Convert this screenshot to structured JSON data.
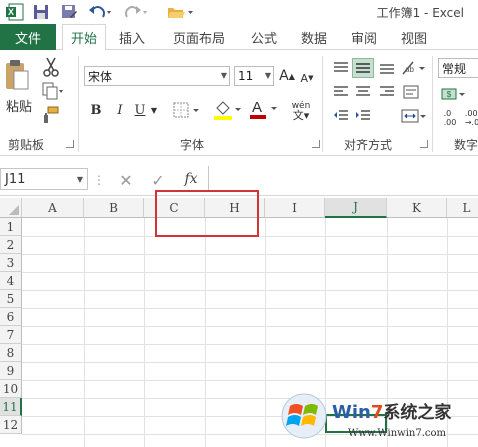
{
  "window": {
    "title": "工作簿1 - Excel"
  },
  "tabs": {
    "file": "文件",
    "home": "开始",
    "insert": "插入",
    "layout": "页面布局",
    "formulas": "公式",
    "data": "数据",
    "review": "审阅",
    "view": "视图"
  },
  "clipboard": {
    "paste": "粘贴",
    "label": "剪贴板"
  },
  "font": {
    "name": "宋体",
    "size": "11",
    "bold": "B",
    "italic": "I",
    "underline": "U",
    "grow": "A",
    "shrink": "A",
    "color_letter": "A",
    "phonetic": "wén",
    "label": "字体"
  },
  "alignment": {
    "label": "对齐方式"
  },
  "number": {
    "format": "常规",
    "label": "数字",
    "inc_decimal": ".0\n.00",
    "dec_decimal": ".00\n→.0"
  },
  "formula_bar": {
    "name_box": "J11",
    "fx": "fx",
    "value": ""
  },
  "columns": [
    "A",
    "B",
    "C",
    "H",
    "I",
    "J",
    "K",
    "L"
  ],
  "selected_column": "J",
  "rows": [
    "1",
    "2",
    "3",
    "4",
    "5",
    "6",
    "7",
    "8",
    "9",
    "10",
    "11",
    "12"
  ],
  "selected_row": "11",
  "watermark": {
    "brand_prefix": "Win",
    "brand_num": "7",
    "brand_cn": "系统之家",
    "url": "Www.Winwin7.com"
  },
  "colors": {
    "accent": "#217346",
    "highlight_box": "#d13438",
    "font_color": "#c00000",
    "fill_color": "#ffff00"
  }
}
